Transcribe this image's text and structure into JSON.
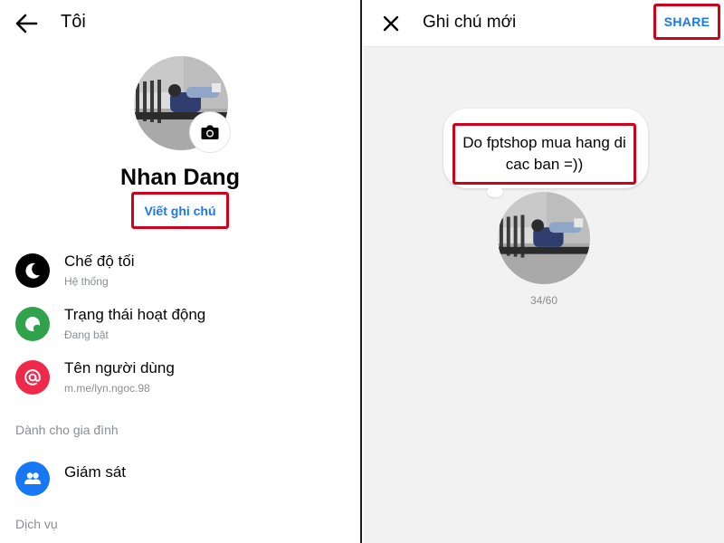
{
  "left": {
    "header_title": "Tôi",
    "profile_name": "Nhan Dang",
    "note_button_label": "Viết ghi chú",
    "menu": [
      {
        "label": "Chế độ tối",
        "sub": "Hệ thống",
        "icon": "moon-icon",
        "color": "#000000"
      },
      {
        "label": "Trạng thái hoạt động",
        "sub": "Đang bật",
        "icon": "active-status-icon",
        "color": "#31a24c"
      },
      {
        "label": "Tên người dùng",
        "sub": "m.me/lyn.ngoc.98",
        "icon": "at-sign-icon",
        "color": "#f02849"
      }
    ],
    "section_family": "Dành cho gia đình",
    "supervision": {
      "label": "Giám sát",
      "icon": "people-icon",
      "color": "#1877f2"
    },
    "section_services": "Dịch vụ"
  },
  "right": {
    "header_title": "Ghi chú mới",
    "share_label": "SHARE",
    "note_text": "Do fptshop mua hang di cac ban =))",
    "char_count": "34/60"
  },
  "colors": {
    "accent": "#1877f2",
    "highlight": "#d0021b"
  }
}
